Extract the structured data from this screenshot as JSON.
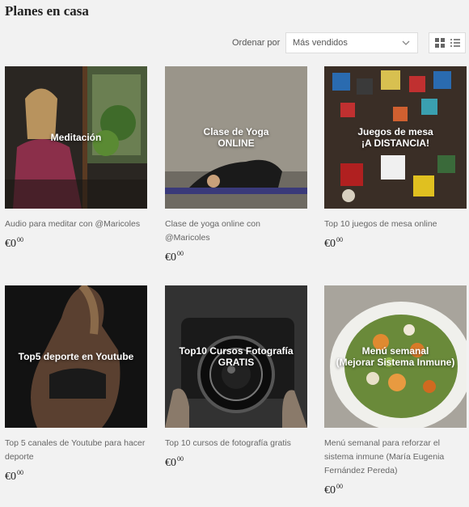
{
  "page": {
    "title": "Planes en casa"
  },
  "toolbar": {
    "sort_label": "Ordenar por",
    "sort_selected": "Más vendidos",
    "view_modes": [
      "grid-view-icon",
      "list-view-icon"
    ]
  },
  "products": [
    {
      "overlay": "Meditación",
      "name": "Audio para meditar con @Maricoles",
      "price_main": "€0",
      "price_cents": "00"
    },
    {
      "overlay": "Clase de Yoga\nONLINE",
      "name": "Clase de yoga online con @Maricoles",
      "price_main": "€0",
      "price_cents": "00"
    },
    {
      "overlay": "Juegos de mesa\n¡A DISTANCIA!",
      "name": "Top 10 juegos de mesa online",
      "price_main": "€0",
      "price_cents": "00"
    },
    {
      "overlay": "Top5 deporte en Youtube",
      "name": "Top 5 canales de Youtube para hacer deporte",
      "price_main": "€0",
      "price_cents": "00"
    },
    {
      "overlay": "Top10 Cursos Fotografía\nGRATIS",
      "name": "Top 10 cursos de fotografía gratis",
      "price_main": "€0",
      "price_cents": "00"
    },
    {
      "overlay": "Menú semanal\n(Mejorar Sistema Inmune)",
      "name": "Menú semanal para reforzar el sistema inmune (María Eugenia Fernández Pereda)",
      "price_main": "€0",
      "price_cents": "00"
    }
  ]
}
